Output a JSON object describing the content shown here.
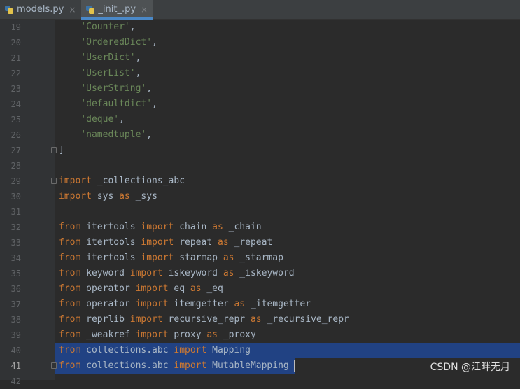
{
  "tabs": [
    {
      "label": "models.py",
      "close": "×"
    },
    {
      "label": "_init_.py",
      "close": "×"
    }
  ],
  "lines": [
    {
      "num": "19",
      "tokens": [
        {
          "t": "    "
        },
        {
          "t": "'Counter'",
          "c": "str"
        },
        {
          "t": ","
        }
      ]
    },
    {
      "num": "20",
      "tokens": [
        {
          "t": "    "
        },
        {
          "t": "'OrderedDict'",
          "c": "str"
        },
        {
          "t": ","
        }
      ]
    },
    {
      "num": "21",
      "tokens": [
        {
          "t": "    "
        },
        {
          "t": "'UserDict'",
          "c": "str"
        },
        {
          "t": ","
        }
      ]
    },
    {
      "num": "22",
      "tokens": [
        {
          "t": "    "
        },
        {
          "t": "'UserList'",
          "c": "str"
        },
        {
          "t": ","
        }
      ]
    },
    {
      "num": "23",
      "tokens": [
        {
          "t": "    "
        },
        {
          "t": "'UserString'",
          "c": "str"
        },
        {
          "t": ","
        }
      ]
    },
    {
      "num": "24",
      "tokens": [
        {
          "t": "    "
        },
        {
          "t": "'defaultdict'",
          "c": "str"
        },
        {
          "t": ","
        }
      ]
    },
    {
      "num": "25",
      "tokens": [
        {
          "t": "    "
        },
        {
          "t": "'deque'",
          "c": "str"
        },
        {
          "t": ","
        }
      ]
    },
    {
      "num": "26",
      "tokens": [
        {
          "t": "    "
        },
        {
          "t": "'namedtuple'",
          "c": "str"
        },
        {
          "t": ","
        }
      ]
    },
    {
      "num": "27",
      "tokens": [
        {
          "t": "]"
        }
      ],
      "fold": true
    },
    {
      "num": "28",
      "tokens": []
    },
    {
      "num": "29",
      "tokens": [
        {
          "t": "import",
          "c": "kw"
        },
        {
          "t": " _collections_abc"
        }
      ],
      "fold": true
    },
    {
      "num": "30",
      "tokens": [
        {
          "t": "import",
          "c": "kw"
        },
        {
          "t": " sys "
        },
        {
          "t": "as",
          "c": "kw"
        },
        {
          "t": " _sys"
        }
      ]
    },
    {
      "num": "31",
      "tokens": []
    },
    {
      "num": "32",
      "tokens": [
        {
          "t": "from",
          "c": "kw"
        },
        {
          "t": " itertools "
        },
        {
          "t": "import",
          "c": "kw"
        },
        {
          "t": " chain "
        },
        {
          "t": "as",
          "c": "kw"
        },
        {
          "t": " _chain"
        }
      ]
    },
    {
      "num": "33",
      "tokens": [
        {
          "t": "from",
          "c": "kw"
        },
        {
          "t": " itertools "
        },
        {
          "t": "import",
          "c": "kw"
        },
        {
          "t": " repeat "
        },
        {
          "t": "as",
          "c": "kw"
        },
        {
          "t": " _repeat"
        }
      ]
    },
    {
      "num": "34",
      "tokens": [
        {
          "t": "from",
          "c": "kw"
        },
        {
          "t": " itertools "
        },
        {
          "t": "import",
          "c": "kw"
        },
        {
          "t": " starmap "
        },
        {
          "t": "as",
          "c": "kw"
        },
        {
          "t": " _starmap"
        }
      ]
    },
    {
      "num": "35",
      "tokens": [
        {
          "t": "from",
          "c": "kw"
        },
        {
          "t": " keyword "
        },
        {
          "t": "import",
          "c": "kw"
        },
        {
          "t": " iskeyword "
        },
        {
          "t": "as",
          "c": "kw"
        },
        {
          "t": " _iskeyword"
        }
      ]
    },
    {
      "num": "36",
      "tokens": [
        {
          "t": "from",
          "c": "kw"
        },
        {
          "t": " operator "
        },
        {
          "t": "import",
          "c": "kw"
        },
        {
          "t": " eq "
        },
        {
          "t": "as",
          "c": "kw"
        },
        {
          "t": " _eq"
        }
      ]
    },
    {
      "num": "37",
      "tokens": [
        {
          "t": "from",
          "c": "kw"
        },
        {
          "t": " operator "
        },
        {
          "t": "import",
          "c": "kw"
        },
        {
          "t": " itemgetter "
        },
        {
          "t": "as",
          "c": "kw"
        },
        {
          "t": " _itemgetter"
        }
      ]
    },
    {
      "num": "38",
      "tokens": [
        {
          "t": "from",
          "c": "kw"
        },
        {
          "t": " reprlib "
        },
        {
          "t": "import",
          "c": "kw"
        },
        {
          "t": " recursive_repr "
        },
        {
          "t": "as",
          "c": "kw"
        },
        {
          "t": " _recursive_repr"
        }
      ]
    },
    {
      "num": "39",
      "tokens": [
        {
          "t": "from",
          "c": "kw"
        },
        {
          "t": " _weakref "
        },
        {
          "t": "import",
          "c": "kw"
        },
        {
          "t": " proxy "
        },
        {
          "t": "as",
          "c": "kw"
        },
        {
          "t": " _proxy"
        }
      ]
    },
    {
      "num": "40",
      "tokens": [
        {
          "t": "from",
          "c": "kw"
        },
        {
          "t": " collections.abc "
        },
        {
          "t": "import",
          "c": "kw"
        },
        {
          "t": " Mapping"
        }
      ],
      "selected": true
    },
    {
      "num": "41",
      "tokens": [
        {
          "t": "from",
          "c": "kw"
        },
        {
          "t": " collections.abc "
        },
        {
          "t": "import",
          "c": "kw"
        },
        {
          "t": " MutableMapping"
        }
      ],
      "selected": true,
      "current": true,
      "fold": true
    },
    {
      "num": "42",
      "tokens": []
    }
  ],
  "watermark": "CSDN @江畔无月",
  "colors": {
    "background": "#2b2b2b",
    "keyword": "#cc7832",
    "string": "#6a8759",
    "selection": "#214283",
    "text": "#a9b7c6"
  },
  "icons": {
    "tab_file": "python-file-icon",
    "tab_close": "close-icon",
    "fold": "fold-marker-icon"
  }
}
